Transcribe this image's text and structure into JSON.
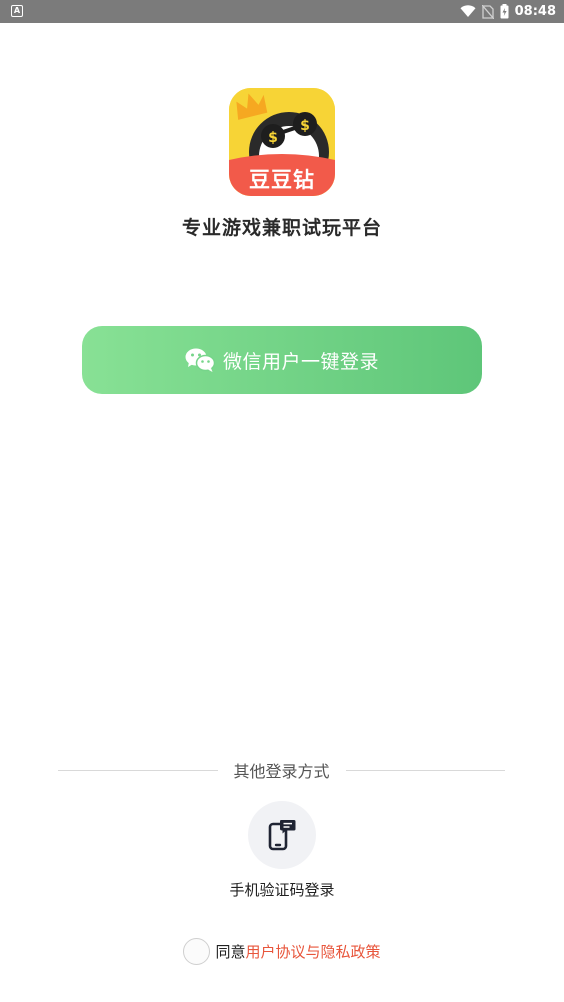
{
  "status_bar": {
    "time": "08:48",
    "left_icon": "notification-a-icon"
  },
  "app": {
    "logo_text": "豆豆钻",
    "tagline": "专业游戏兼职试玩平台"
  },
  "wechat_login": {
    "label": "微信用户一键登录"
  },
  "other_login": {
    "title": "其他登录方式",
    "phone_label": "手机验证码登录"
  },
  "agreement": {
    "prefix": "同意",
    "link": "用户协议与隐私政策"
  },
  "colors": {
    "button_start": "#88e195",
    "button_end": "#5ec679",
    "link": "#e8553b",
    "logo_yellow": "#f7d436",
    "logo_red": "#f25a4a"
  }
}
